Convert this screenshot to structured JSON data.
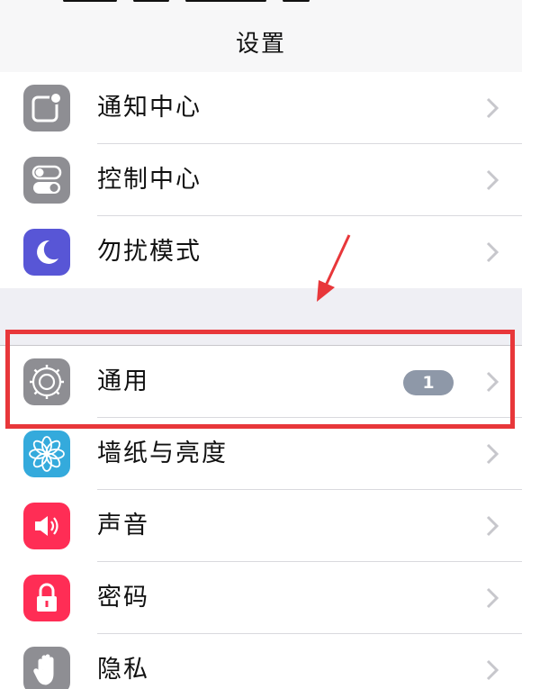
{
  "nav": {
    "title": "设置"
  },
  "group1": [
    {
      "label": "通知中心",
      "icon": "notification-center-icon",
      "color": "#8e8e93"
    },
    {
      "label": "控制中心",
      "icon": "control-center-icon",
      "color": "#8e8e93"
    },
    {
      "label": "勿扰模式",
      "icon": "moon-icon",
      "color": "#5856d6"
    }
  ],
  "group2": [
    {
      "label": "通用",
      "icon": "gear-icon",
      "color": "#8e8e93",
      "badge": "1"
    },
    {
      "label": "墙纸与亮度",
      "icon": "flower-icon",
      "color": "#34aadc"
    },
    {
      "label": "声音",
      "icon": "speaker-icon",
      "color": "#ff2d55"
    },
    {
      "label": "密码",
      "icon": "lock-icon",
      "color": "#ff2d55"
    },
    {
      "label": "隐私",
      "icon": "hand-icon",
      "color": "#8e8e93"
    }
  ],
  "annotation": {
    "highlight_color": "#e8373a"
  }
}
